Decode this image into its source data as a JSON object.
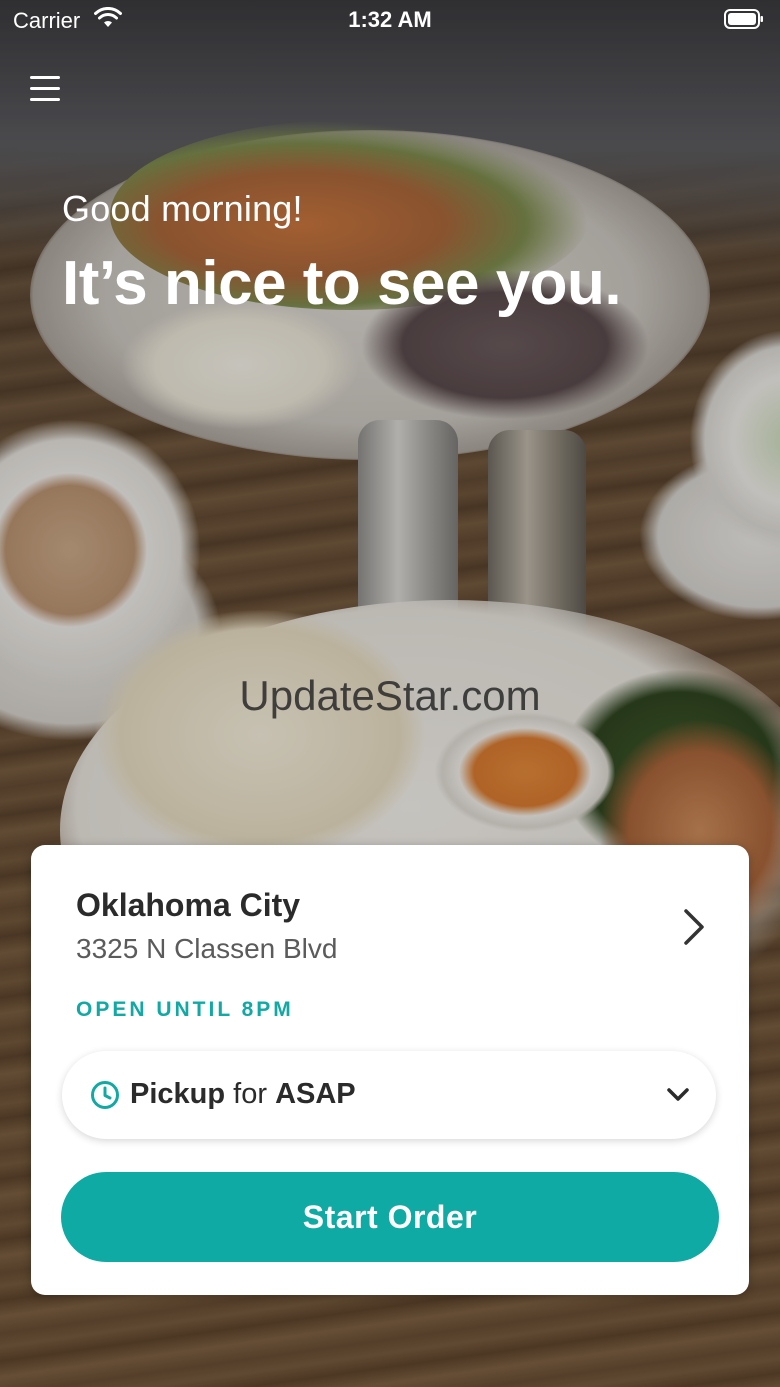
{
  "status_bar": {
    "carrier": "Carrier",
    "time": "1:32 AM",
    "icons": [
      "wifi-icon",
      "battery-icon"
    ]
  },
  "header": {
    "menu_icon": "hamburger-menu-icon"
  },
  "hero": {
    "greeting": "Good morning!",
    "headline": "It’s nice to see you."
  },
  "watermark": "UpdateStar.com",
  "location_card": {
    "city": "Oklahoma City",
    "address": "3325 N Classen Blvd",
    "hours": "OPEN UNTIL 8PM",
    "pickup": {
      "mode": "Pickup",
      "connector": "for",
      "time": "ASAP"
    },
    "start_order_label": "Start Order"
  },
  "colors": {
    "accent": "#0faaa3",
    "text_dark": "#2b2b2b",
    "text_muted": "#5b5b5b",
    "card_bg": "#ffffff"
  }
}
